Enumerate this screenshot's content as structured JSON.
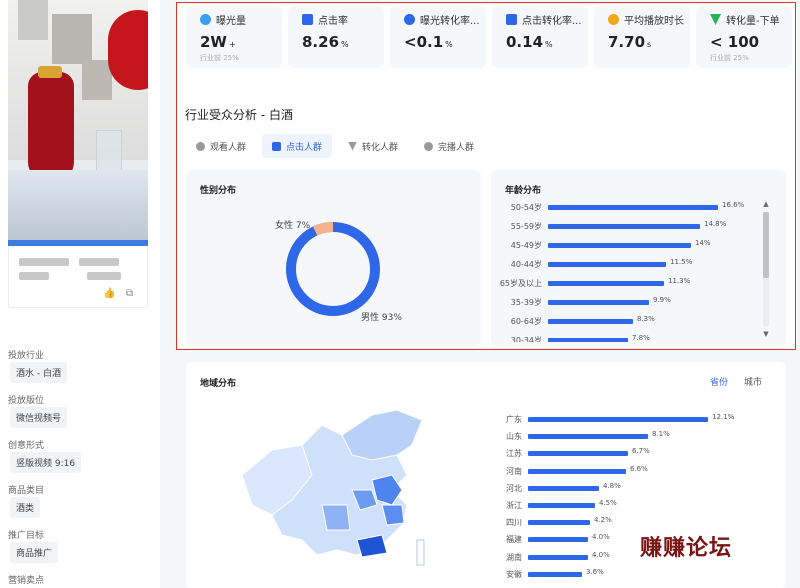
{
  "metrics": [
    {
      "label": "曝光量",
      "value": "2W",
      "suffix": "+",
      "sub": "行业前 25%",
      "icon": "eye-icon",
      "color": "#3aa0f0"
    },
    {
      "label": "点击率",
      "value": "8.26",
      "suffix": "%",
      "sub": "",
      "icon": "finger-click-icon",
      "color": "#2e67e8"
    },
    {
      "label": "曝光转化率...",
      "value": "<0.1",
      "suffix": "%",
      "sub": "",
      "icon": "conversion-icon",
      "color": "#2e67e8"
    },
    {
      "label": "点击转化率...",
      "value": "0.14",
      "suffix": "%",
      "sub": "",
      "icon": "click-convert-icon",
      "color": "#2e67e8"
    },
    {
      "label": "平均播放时长",
      "value": "7.70",
      "suffix": "s",
      "sub": "",
      "icon": "coins-icon",
      "color": "#f2a81d"
    },
    {
      "label": "转化量-下单",
      "value": "< 100",
      "suffix": "",
      "sub": "行业前 25%",
      "icon": "funnel-icon",
      "color": "#27b35a"
    }
  ],
  "section_title": "行业受众分析 - 白酒",
  "tabs": [
    {
      "label": "观看人群",
      "active": false
    },
    {
      "label": "点击人群",
      "active": true
    },
    {
      "label": "转化人群",
      "active": false
    },
    {
      "label": "完播人群",
      "active": false
    }
  ],
  "gender": {
    "title": "性别分布",
    "female_label": "女性 7%",
    "male_label": "男性 93%",
    "female_pct": 7,
    "male_pct": 93,
    "female_color": "#f6b28c",
    "male_color": "#2e67e8"
  },
  "age": {
    "title": "年龄分布",
    "rows": [
      {
        "label": "50-54岁",
        "value": 16.6,
        "text": "16.6%"
      },
      {
        "label": "55-59岁",
        "value": 14.8,
        "text": "14.8%"
      },
      {
        "label": "45-49岁",
        "value": 14,
        "text": "14%"
      },
      {
        "label": "40-44岁",
        "value": 11.5,
        "text": "11.5%"
      },
      {
        "label": "65岁及以上",
        "value": 11.3,
        "text": "11.3%"
      },
      {
        "label": "35-39岁",
        "value": 9.9,
        "text": "9.9%"
      },
      {
        "label": "60-64岁",
        "value": 8.3,
        "text": "8.3%"
      },
      {
        "label": "30-34岁",
        "value": 7.8,
        "text": "7.8%"
      }
    ]
  },
  "region": {
    "title": "地域分布",
    "tab_province": "省份",
    "tab_city": "城市",
    "rows": [
      {
        "label": "广东",
        "value": 12.1,
        "text": "12.1%"
      },
      {
        "label": "山东",
        "value": 8.1,
        "text": "8.1%"
      },
      {
        "label": "江苏",
        "value": 6.7,
        "text": "6.7%"
      },
      {
        "label": "河南",
        "value": 6.6,
        "text": "6.6%"
      },
      {
        "label": "河北",
        "value": 4.8,
        "text": "4.8%"
      },
      {
        "label": "浙江",
        "value": 4.5,
        "text": "4.5%"
      },
      {
        "label": "四川",
        "value": 4.2,
        "text": "4.2%"
      },
      {
        "label": "福建",
        "value": 4.0,
        "text": "4.0%"
      },
      {
        "label": "湖南",
        "value": 4.0,
        "text": "4.0%"
      },
      {
        "label": "安徽",
        "value": 3.6,
        "text": "3.6%"
      }
    ]
  },
  "left": {
    "fields": [
      {
        "label": "投放行业",
        "value": "酒水 - 白酒"
      },
      {
        "label": "投放版位",
        "value": "微信视频号"
      },
      {
        "label": "创意形式",
        "value": "竖版视频 9:16"
      },
      {
        "label": "商品类目",
        "value": "酒类"
      },
      {
        "label": "推广目标",
        "value": "商品推广"
      },
      {
        "label": "营销卖点",
        "value": ""
      }
    ]
  },
  "watermark": "赚赚论坛"
}
